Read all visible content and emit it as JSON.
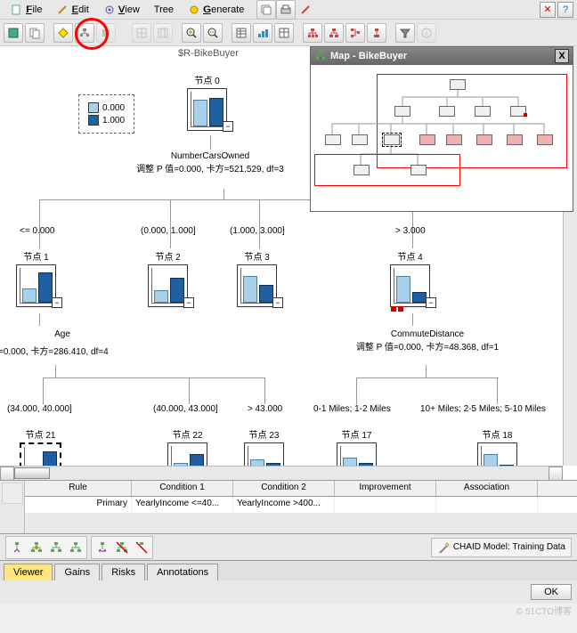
{
  "menu": {
    "file": "File",
    "edit": "Edit",
    "view": "View",
    "tree": "Tree",
    "generate": "Generate"
  },
  "map": {
    "title": "Map - BikeBuyer",
    "close": "X"
  },
  "legend": {
    "v0": "0.000",
    "v1": "1.000"
  },
  "tree": {
    "header": "$R-BikeBuyer",
    "root": {
      "title": "节点 0"
    },
    "split1_name": "NumberCarsOwned",
    "split1_stats": "调整 P 值=0.000, 卡方=521.529, df=3",
    "children": [
      {
        "cond": "<= 0.000",
        "title": "节点 1"
      },
      {
        "cond": "(0.000, 1.000]",
        "title": "节点 2"
      },
      {
        "cond": "(1.000, 3.000]",
        "title": "节点 3"
      },
      {
        "cond": "> 3.000",
        "title": "节点 4"
      }
    ],
    "split2a_name": "Age",
    "split2a_stats": "=0.000, 卡方=286.410, df=4",
    "split2b_name": "CommuteDistance",
    "split2b_stats": "调整 P 值=0.000, 卡方=48.368, df=1",
    "leaves_a": [
      {
        "cond": "(34.000, 40.000]",
        "title": "节点 21"
      },
      {
        "cond": "(40.000, 43.000]",
        "title": "节点 22"
      },
      {
        "cond": "> 43.000",
        "title": "节点 23"
      }
    ],
    "leaves_b": [
      {
        "cond": "0-1 Miles; 1-2 Miles",
        "title": "节点 17"
      },
      {
        "cond": "10+ Miles; 2-5 Miles; 5-10 Miles",
        "title": "节点 18"
      }
    ]
  },
  "rules": {
    "headers": {
      "rule": "Rule",
      "c1": "Condition 1",
      "c2": "Condition 2",
      "imp": "Improvement",
      "assoc": "Association"
    },
    "row": {
      "rule": "Primary",
      "c1": "YearlyIncome <=40...",
      "c2": "YearlyIncome >400...",
      "imp": "",
      "assoc": ""
    }
  },
  "model_label": "CHAID Model: Training Data",
  "tabs": {
    "viewer": "Viewer",
    "gains": "Gains",
    "risks": "Risks",
    "annotations": "Annotations"
  },
  "footer": {
    "ok": "OK"
  },
  "watermark": "© 51CTO博客"
}
